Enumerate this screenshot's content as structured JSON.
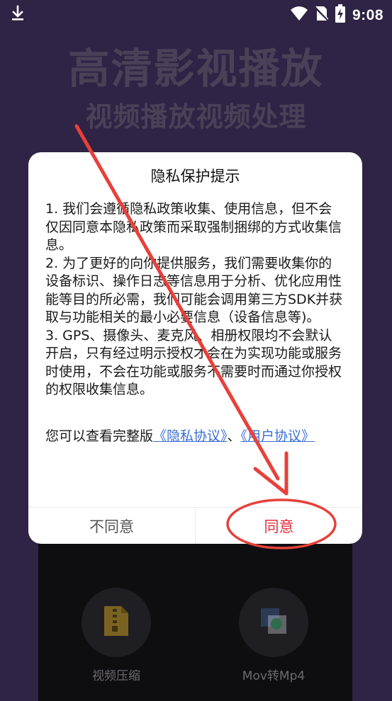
{
  "status_bar": {
    "time": "9:08",
    "icons": [
      "download-icon",
      "wifi-icon",
      "no-sim-icon",
      "battery-charging-icon"
    ]
  },
  "background": {
    "title": "高清影视播放",
    "subtitle": "视频播放视频处理",
    "tools": [
      {
        "label": "视频压缩",
        "icon": "zip-file-icon"
      },
      {
        "label": "Mov转Mp4",
        "icon": "convert-icon"
      }
    ]
  },
  "dialog": {
    "title": "隐私保护提示",
    "paragraphs": [
      "1. 我们会遵循隐私政策收集、使用信息，但不会仅因同意本隐私政策而采取强制捆绑的方式收集信息。",
      "2. 为了更好的向你提供服务，我们需要收集你的设备标识、操作日志等信息用于分析、优化应用性能等目的所必需，我们可能会调用第三方SDK并获取与功能相关的最小必要信息（设备信息等)。",
      "3. GPS、摄像头、麦克风、相册权限均不会默认开启，只有经过明示授权才会在为实现功能或服务时使用，不会在功能或服务不需要时而通过你授权的权限收集信息。"
    ],
    "links_prefix": "您可以查看完整版",
    "privacy_link": "《隐私协议》",
    "separator": "、",
    "user_link": "《用户协议》",
    "disagree_label": "不同意",
    "agree_label": "同意"
  },
  "colors": {
    "background": "#2f2445",
    "agree": "#e02d3c",
    "link": "#3b6fd4",
    "annotation": "#e8403a"
  }
}
